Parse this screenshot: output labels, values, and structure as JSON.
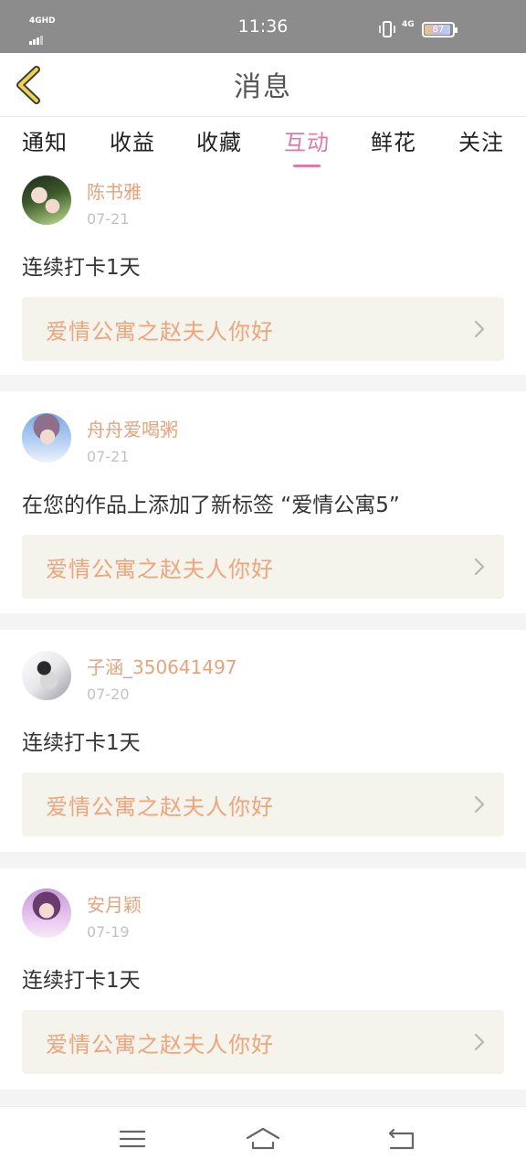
{
  "status_bar": {
    "network": "4GHD",
    "time": "11:36",
    "net_right": "4G",
    "battery_percent": "87"
  },
  "header": {
    "title": "消息",
    "back_icon": "chevron-left-icon"
  },
  "tabs": [
    {
      "label": "通知",
      "active": false
    },
    {
      "label": "收益",
      "active": false
    },
    {
      "label": "收藏",
      "active": false
    },
    {
      "label": "互动",
      "active": true
    },
    {
      "label": "鲜花",
      "active": false
    },
    {
      "label": "关注",
      "active": false
    }
  ],
  "feed": [
    {
      "username": "陈书雅",
      "date": "07-21",
      "message": "连续打卡1天",
      "work_title": "爱情公寓之赵夫人你好"
    },
    {
      "username": "舟舟爱喝粥",
      "date": "07-21",
      "message": "在您的作品上添加了新标签 “爱情公寓5”",
      "work_title": "爱情公寓之赵夫人你好"
    },
    {
      "username": "子涵_350641497",
      "date": "07-20",
      "message": "连续打卡1天",
      "work_title": "爱情公寓之赵夫人你好"
    },
    {
      "username": "安月颖",
      "date": "07-19",
      "message": "连续打卡1天",
      "work_title": "爱情公寓之赵夫人你好"
    }
  ],
  "colors": {
    "accent": "#e07aa6",
    "username": "#e9a27a",
    "work_title": "#eea57c",
    "work_bg": "#f4f4ec",
    "status_bar": "#8c8c8c"
  },
  "nav_bar": {
    "menu_icon": "menu-icon",
    "home_icon": "home-icon",
    "back_icon": "return-icon"
  }
}
